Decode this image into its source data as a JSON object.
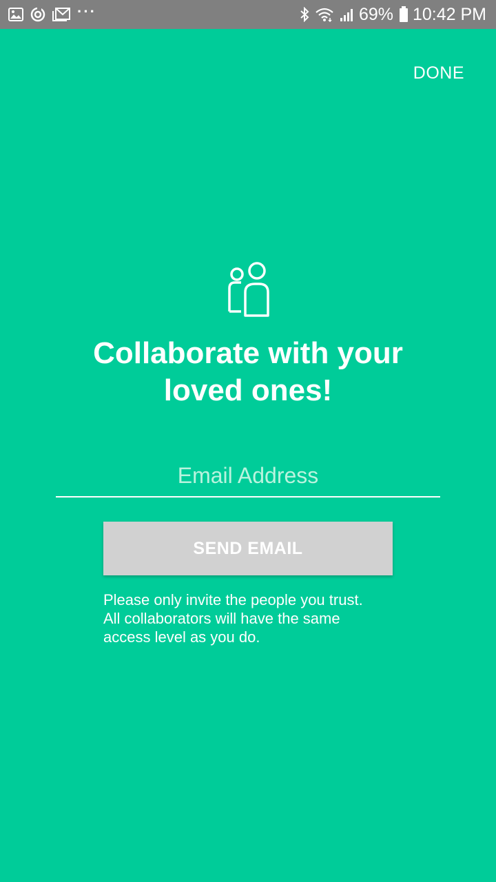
{
  "status_bar": {
    "left_icons": [
      "gallery-icon",
      "sync-icon",
      "gmail-icon",
      "more-dots-icon"
    ],
    "right_icons": [
      "bluetooth-icon",
      "wifi-icon",
      "signal-icon",
      "battery-icon"
    ],
    "more_dots": "···",
    "battery_percent": "69%",
    "time": "10:42 PM"
  },
  "header": {
    "done_label": "DONE"
  },
  "main": {
    "icon": "people-icon",
    "headline_line1": "Collaborate with your",
    "headline_line2": "loved ones!",
    "email_placeholder": "Email Address",
    "email_value": "",
    "send_label": "SEND EMAIL",
    "note_line1": "Please only invite the people you trust.",
    "note_line2": "All collaborators will have the same",
    "note_line3": "access level as you do."
  },
  "colors": {
    "background": "#00cc99",
    "status_bar": "#808080",
    "button": "#d1d1d1",
    "placeholder": "#b9f3de"
  }
}
